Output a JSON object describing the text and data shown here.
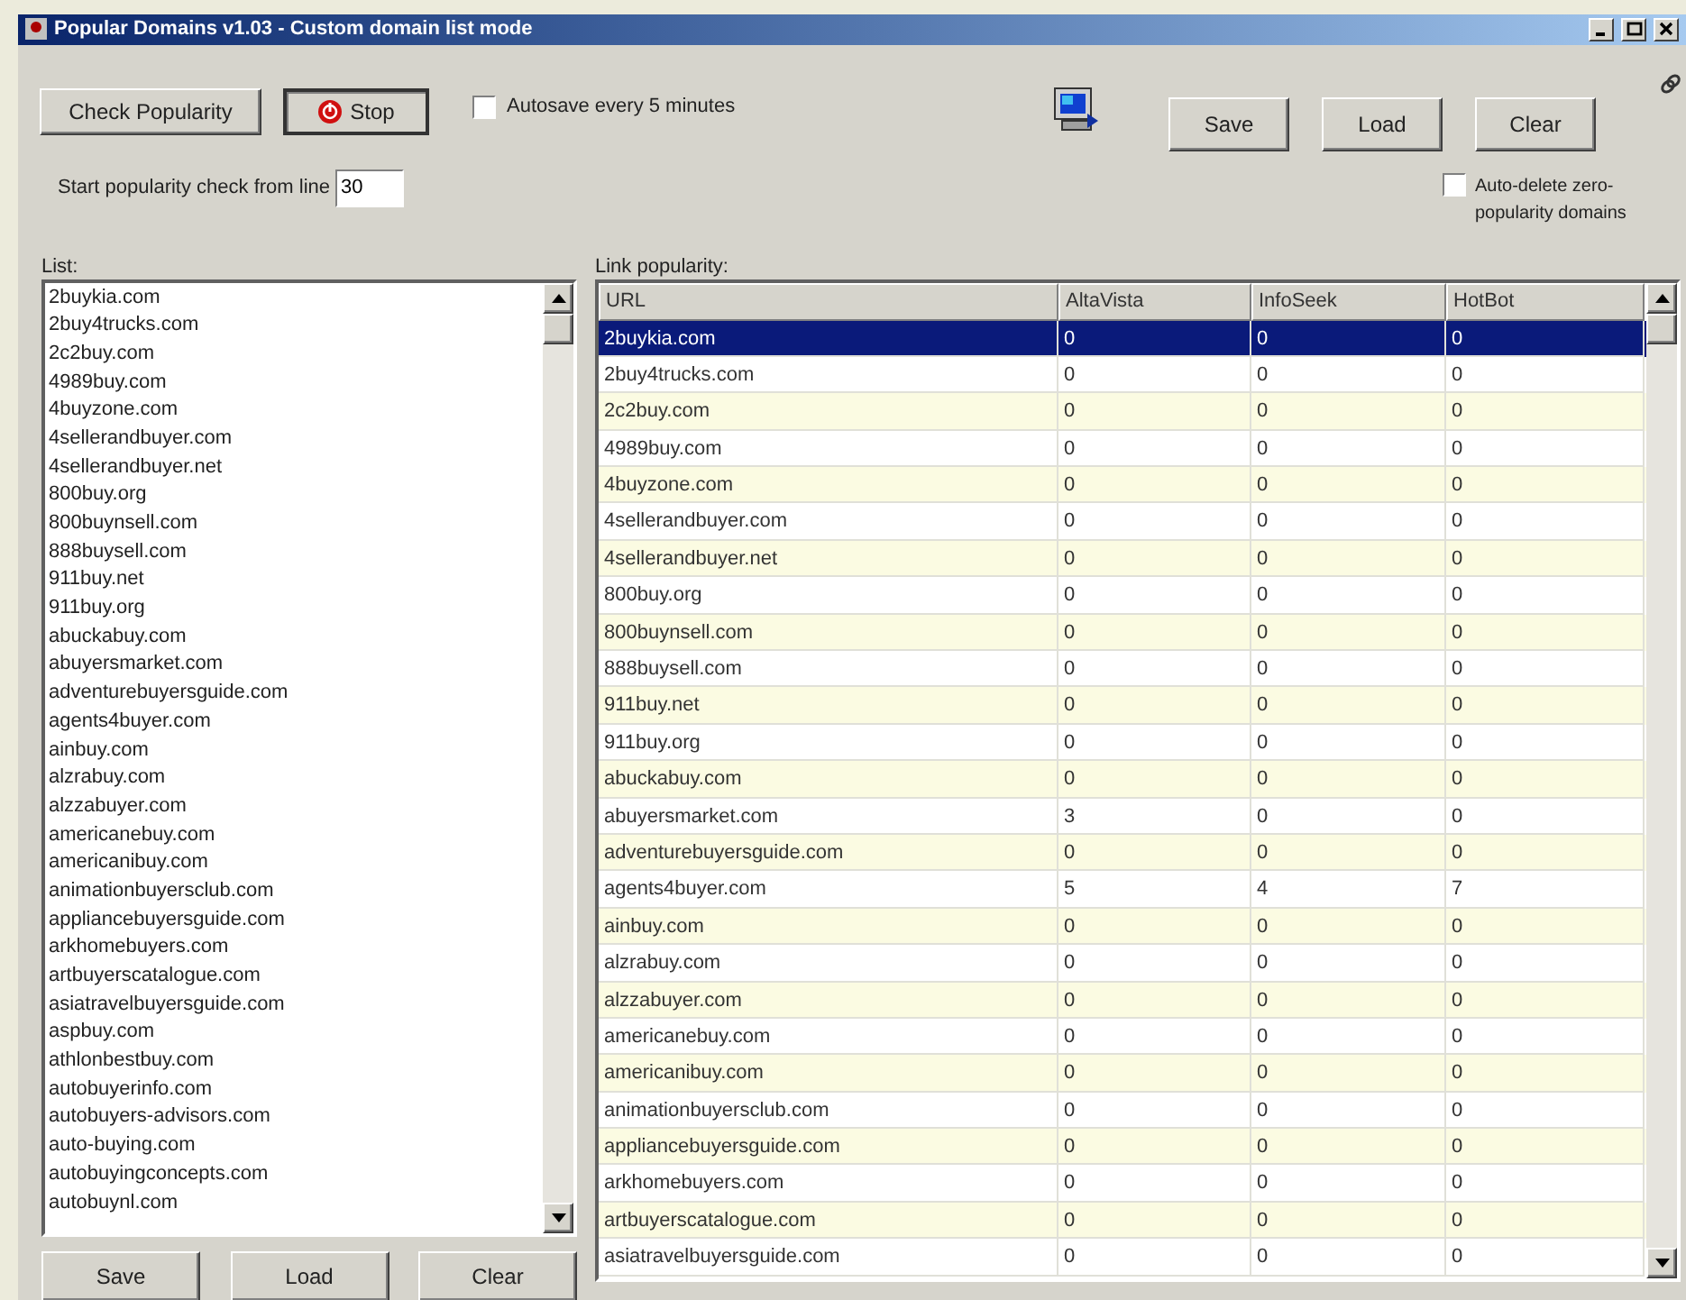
{
  "window": {
    "title": "Popular Domains v1.03 - Custom domain list mode"
  },
  "toolbar": {
    "buttons": [
      {
        "label": "Check Popularity",
        "kind": "plain",
        "pressed": false
      },
      {
        "label": "Stop",
        "kind": "stop",
        "pressed": true
      }
    ],
    "autosave": {
      "label": "Autosave every 5 minutes",
      "checked": false
    },
    "file_buttons": [
      "Save",
      "Load",
      "Clear"
    ],
    "start_line": {
      "label": "Start popularity check from line",
      "value": "30"
    },
    "auto_delete": {
      "label": "Auto-delete zero-popularity domains",
      "checked": false
    }
  },
  "list": {
    "label": "List:",
    "items": [
      "2buykia.com",
      "2buy4trucks.com",
      "2c2buy.com",
      "4989buy.com",
      "4buyzone.com",
      "4sellerandbuyer.com",
      "4sellerandbuyer.net",
      "800buy.org",
      "800buynsell.com",
      "888buysell.com",
      "911buy.net",
      "911buy.org",
      "abuckabuy.com",
      "abuyersmarket.com",
      "adventurebuyersguide.com",
      "agents4buyer.com",
      "ainbuy.com",
      "alzrabuy.com",
      "alzzabuyer.com",
      "americanebuy.com",
      "americanibuy.com",
      "animationbuyersclub.com",
      "appliancebuyersguide.com",
      "arkhomebuyers.com",
      "artbuyerscatalogue.com",
      "asiatravelbuyersguide.com",
      "aspbuy.com",
      "athlonbestbuy.com",
      "autobuyerinfo.com",
      "autobuyers-advisors.com",
      "auto-buying.com",
      "autobuyingconcepts.com",
      "autobuynl.com"
    ],
    "buttons": [
      "Save",
      "Load",
      "Clear"
    ]
  },
  "table": {
    "label": "Link popularity:",
    "columns": [
      "URL",
      "AltaVista",
      "InfoSeek",
      "HotBot"
    ],
    "rows": [
      {
        "cells": [
          "2buykia.com",
          "0",
          "0",
          "0"
        ],
        "selected": true
      },
      {
        "cells": [
          "2buy4trucks.com",
          "0",
          "0",
          "0"
        ],
        "selected": false
      },
      {
        "cells": [
          "2c2buy.com",
          "0",
          "0",
          "0"
        ],
        "selected": false
      },
      {
        "cells": [
          "4989buy.com",
          "0",
          "0",
          "0"
        ],
        "selected": false
      },
      {
        "cells": [
          "4buyzone.com",
          "0",
          "0",
          "0"
        ],
        "selected": false
      },
      {
        "cells": [
          "4sellerandbuyer.com",
          "0",
          "0",
          "0"
        ],
        "selected": false
      },
      {
        "cells": [
          "4sellerandbuyer.net",
          "0",
          "0",
          "0"
        ],
        "selected": false
      },
      {
        "cells": [
          "800buy.org",
          "0",
          "0",
          "0"
        ],
        "selected": false
      },
      {
        "cells": [
          "800buynsell.com",
          "0",
          "0",
          "0"
        ],
        "selected": false
      },
      {
        "cells": [
          "888buysell.com",
          "0",
          "0",
          "0"
        ],
        "selected": false
      },
      {
        "cells": [
          "911buy.net",
          "0",
          "0",
          "0"
        ],
        "selected": false
      },
      {
        "cells": [
          "911buy.org",
          "0",
          "0",
          "0"
        ],
        "selected": false
      },
      {
        "cells": [
          "abuckabuy.com",
          "0",
          "0",
          "0"
        ],
        "selected": false
      },
      {
        "cells": [
          "abuyersmarket.com",
          "3",
          "0",
          "0"
        ],
        "selected": false
      },
      {
        "cells": [
          "adventurebuyersguide.com",
          "0",
          "0",
          "0"
        ],
        "selected": false
      },
      {
        "cells": [
          "agents4buyer.com",
          "5",
          "4",
          "7"
        ],
        "selected": false
      },
      {
        "cells": [
          "ainbuy.com",
          "0",
          "0",
          "0"
        ],
        "selected": false
      },
      {
        "cells": [
          "alzrabuy.com",
          "0",
          "0",
          "0"
        ],
        "selected": false
      },
      {
        "cells": [
          "alzzabuyer.com",
          "0",
          "0",
          "0"
        ],
        "selected": false
      },
      {
        "cells": [
          "americanebuy.com",
          "0",
          "0",
          "0"
        ],
        "selected": false
      },
      {
        "cells": [
          "americanibuy.com",
          "0",
          "0",
          "0"
        ],
        "selected": false
      },
      {
        "cells": [
          "animationbuyersclub.com",
          "0",
          "0",
          "0"
        ],
        "selected": false
      },
      {
        "cells": [
          "appliancebuyersguide.com",
          "0",
          "0",
          "0"
        ],
        "selected": false
      },
      {
        "cells": [
          "arkhomebuyers.com",
          "0",
          "0",
          "0"
        ],
        "selected": false
      },
      {
        "cells": [
          "artbuyerscatalogue.com",
          "0",
          "0",
          "0"
        ],
        "selected": false
      },
      {
        "cells": [
          "asiatravelbuyersguide.com",
          "0",
          "0",
          "0"
        ],
        "selected": false
      }
    ]
  }
}
